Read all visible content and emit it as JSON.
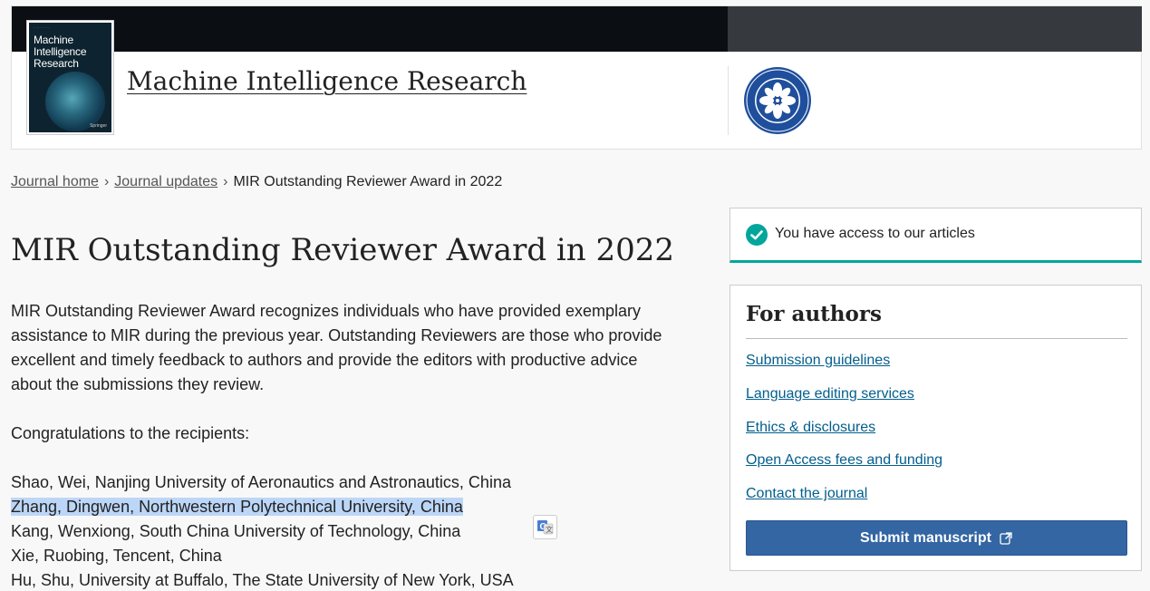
{
  "header": {
    "journal_title": "Machine Intelligence Research",
    "cover": {
      "title_line1": "Machine",
      "title_line2": "Intelligence",
      "title_line3": "Research",
      "publisher_mark": "Springer"
    }
  },
  "breadcrumb": {
    "items": [
      "Journal home",
      "Journal updates"
    ],
    "current": "MIR Outstanding Reviewer Award in 2022",
    "separator": "›"
  },
  "article": {
    "title": "MIR Outstanding Reviewer Award in 2022",
    "intro": "MIR Outstanding Reviewer Award recognizes individuals who have provided exemplary assistance to MIR during the previous year. Outstanding Reviewers are those who provide excellent and timely feedback to authors and provide the editors with productive advice about the submissions they review.",
    "congrats": "Congratulations to the recipients:",
    "recipients": [
      "Shao, Wei, Nanjing University of Aeronautics and Astronautics, China",
      "Zhang, Dingwen, Northwestern Polytechnical University, China",
      "Kang, Wenxiong, South China University of Technology, China",
      "Xie, Ruobing, Tencent, China",
      "Hu, Shu, University at Buffalo, The State University of New York, USA"
    ]
  },
  "sidebar": {
    "access_text": "You have access to our articles",
    "for_authors": {
      "heading": "For authors",
      "links": [
        "Submission guidelines",
        "Language editing services",
        "Ethics & disclosures",
        "Open Access fees and funding",
        "Contact the journal"
      ],
      "submit_label": "Submit manuscript"
    }
  },
  "icons": {
    "access": "check-circle-icon",
    "submit": "external-link-icon",
    "translate": "google-translate-icon",
    "logo": "chinese-academy-of-sciences-logo"
  },
  "colors": {
    "header_dark": "#0b0f14",
    "header_grey": "#363a3e",
    "accent_teal": "#00a69c",
    "link_blue": "#025e8d",
    "submit_blue": "#3366a3",
    "highlight": "#bcd6f7"
  }
}
